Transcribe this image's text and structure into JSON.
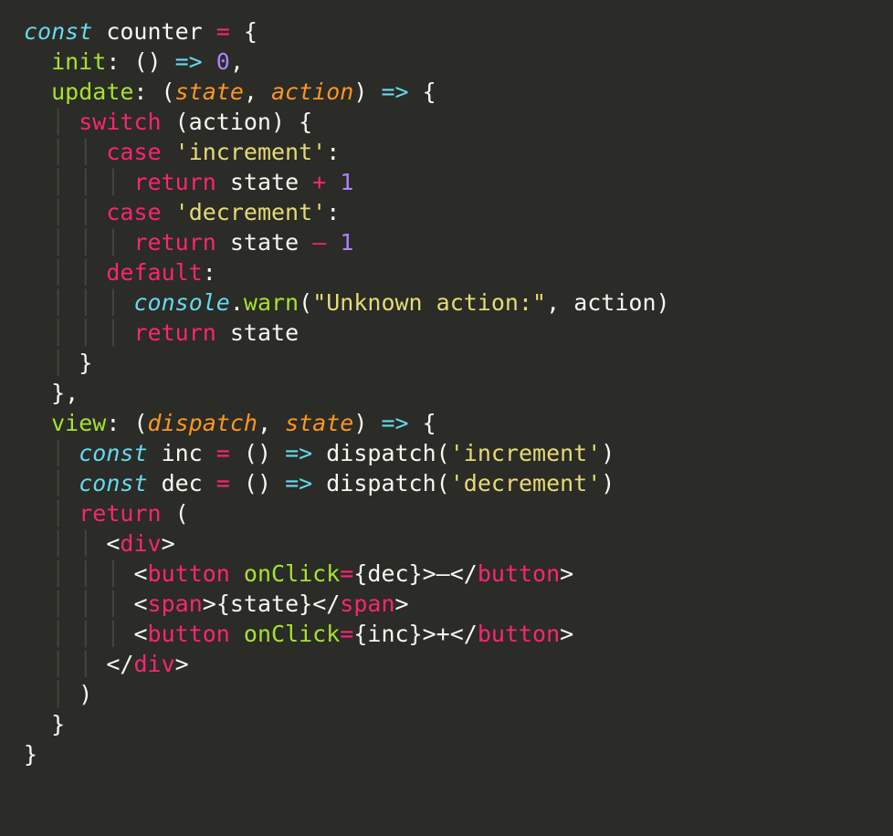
{
  "code": {
    "line1": {
      "kw": "const",
      "name": "counter",
      "eq": "=",
      "brace": "{"
    },
    "line2": {
      "prop": "init",
      "colon": ":",
      "lp": "()",
      "arrow": "=>",
      "val": "0",
      "comma": ","
    },
    "line3": {
      "prop": "update",
      "colon": ":",
      "lp": "(",
      "p1": "state",
      "c": ",",
      "p2": "action",
      "rp": ")",
      "arrow": "=>",
      "brace": "{"
    },
    "line4": {
      "kw": "switch",
      "lp": "(action)",
      "brace": "{"
    },
    "line5": {
      "kw": "case",
      "str": "'increment'",
      "colon": ":"
    },
    "line6": {
      "kw": "return",
      "expr": "state",
      "op": "+",
      "num": "1"
    },
    "line7": {
      "kw": "case",
      "str": "'decrement'",
      "colon": ":"
    },
    "line8": {
      "kw": "return",
      "expr": "state",
      "op": "–",
      "num": "1"
    },
    "line9": {
      "kw": "default",
      "colon": ":"
    },
    "line10": {
      "obj": "console",
      "dot": ".",
      "fn": "warn",
      "lp": "(",
      "str": "\"Unknown action:\"",
      "c": ",",
      "arg": "action",
      "rp": ")"
    },
    "line11": {
      "kw": "return",
      "expr": "state"
    },
    "line12": {
      "brace": "}"
    },
    "line13": {
      "brace": "},"
    },
    "line14": {
      "prop": "view",
      "colon": ":",
      "lp": "(",
      "p1": "dispatch",
      "c": ",",
      "p2": "state",
      "rp": ")",
      "arrow": "=>",
      "brace": "{"
    },
    "line15": {
      "kw": "const",
      "name": "inc",
      "eq": "=",
      "lp": "()",
      "arrow": "=>",
      "call": "dispatch(",
      "str": "'increment'",
      "rp": ")"
    },
    "line16": {
      "kw": "const",
      "name": "dec",
      "eq": "=",
      "lp": "()",
      "arrow": "=>",
      "call": "dispatch(",
      "str": "'decrement'",
      "rp": ")"
    },
    "line17": {
      "kw": "return",
      "lp": "("
    },
    "line18": {
      "open": "<",
      "tag": "div",
      "close": ">"
    },
    "line19": {
      "open": "<",
      "tag": "button",
      "sp": " ",
      "attr": "onClick",
      "eq": "=",
      "val": "{dec}",
      "close": ">",
      "text": "–",
      "open2": "</",
      "tag2": "button",
      "close2": ">"
    },
    "line20": {
      "open": "<",
      "tag": "span",
      "close": ">",
      "text": "{state}",
      "open2": "</",
      "tag2": "span",
      "close2": ">"
    },
    "line21": {
      "open": "<",
      "tag": "button",
      "sp": " ",
      "attr": "onClick",
      "eq": "=",
      "val": "{inc}",
      "close": ">",
      "text": "+",
      "open2": "</",
      "tag2": "button",
      "close2": ">"
    },
    "line22": {
      "open": "</",
      "tag": "div",
      "close": ">"
    },
    "line23": {
      "rp": ")"
    },
    "line24": {
      "brace": "}"
    },
    "line25": {
      "brace": "}"
    }
  }
}
